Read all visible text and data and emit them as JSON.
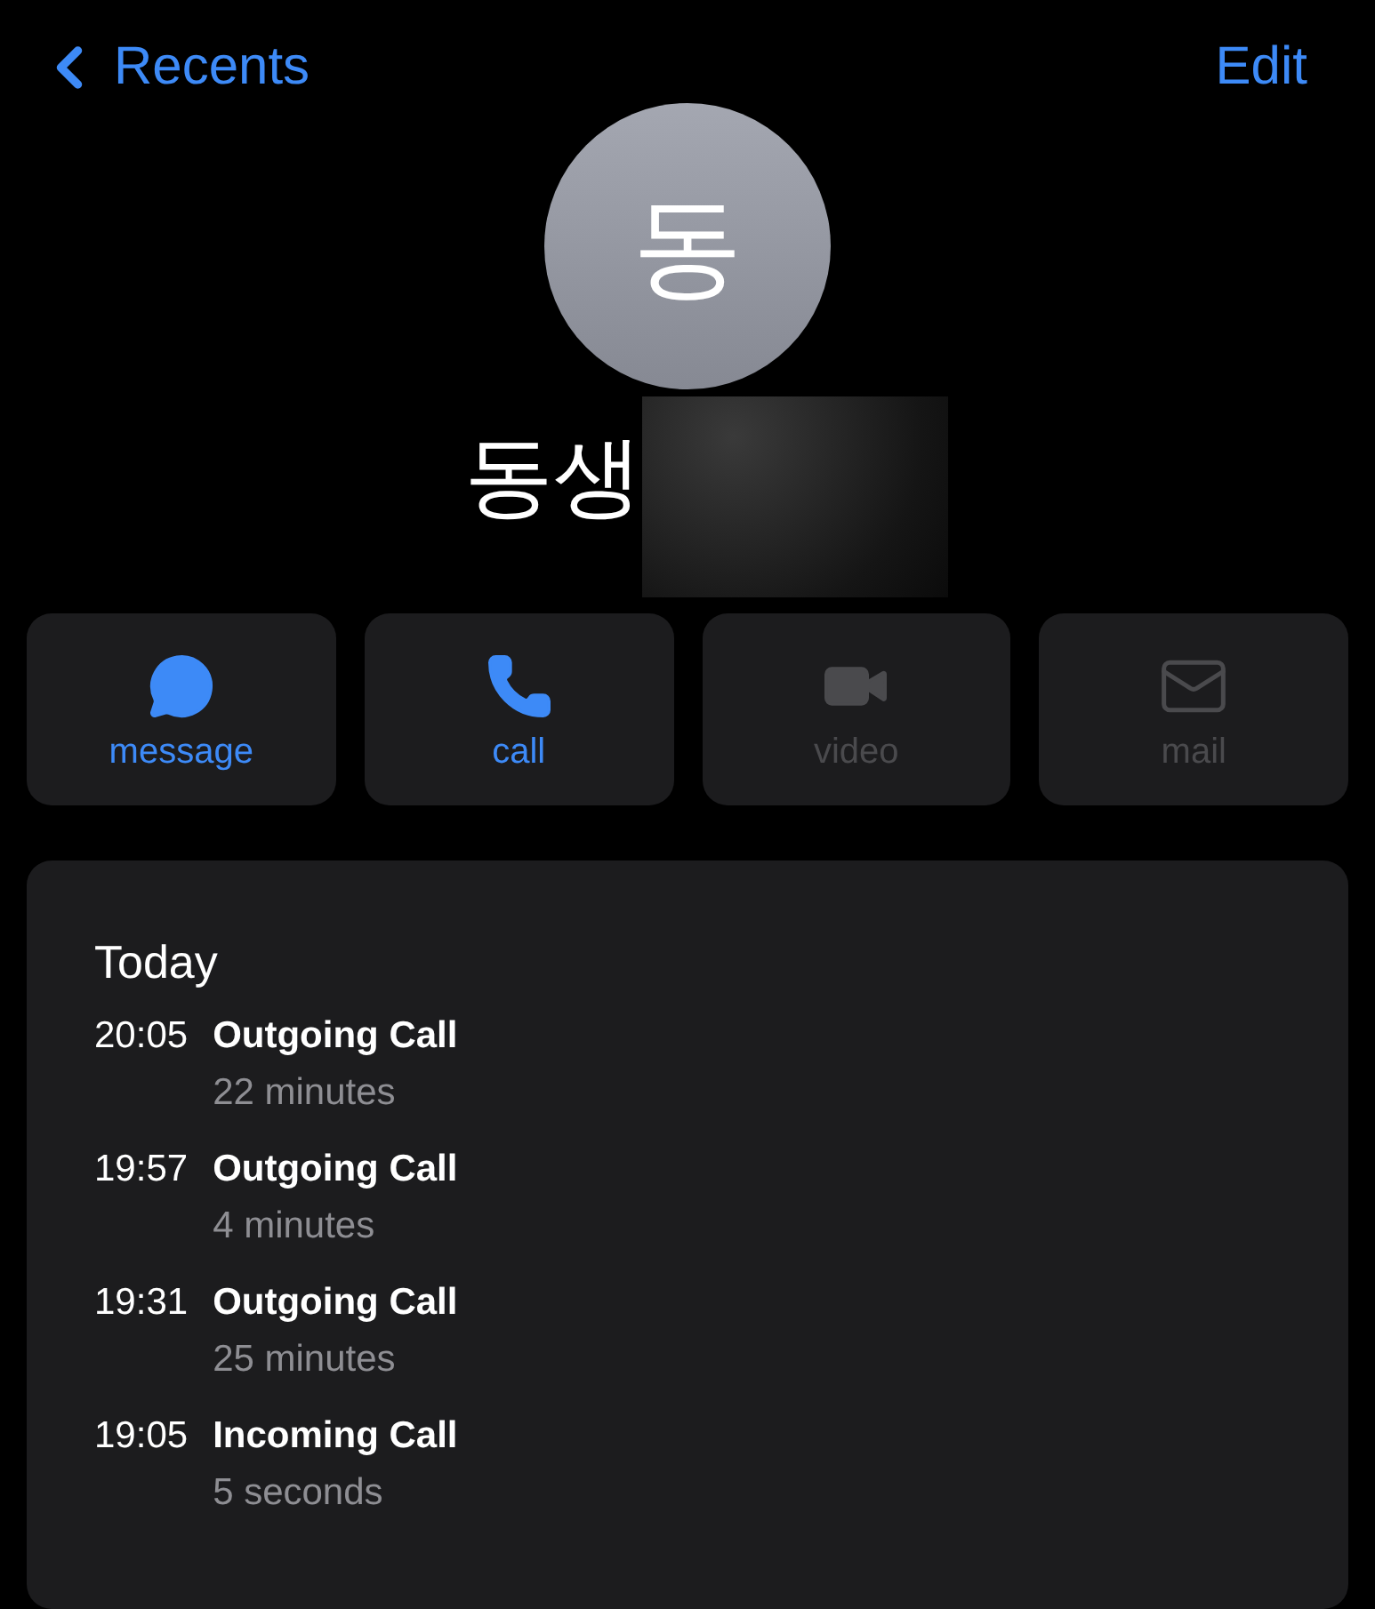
{
  "nav": {
    "back_label": "Recents",
    "edit_label": "Edit"
  },
  "contact": {
    "initial": "동",
    "name": "동생",
    "name_redacted": true
  },
  "actions": [
    {
      "kind": "message",
      "label": "message",
      "disabled": false
    },
    {
      "kind": "call",
      "label": "call",
      "disabled": false
    },
    {
      "kind": "video",
      "label": "video",
      "disabled": true
    },
    {
      "kind": "mail",
      "label": "mail",
      "disabled": true
    }
  ],
  "history": {
    "heading": "Today",
    "calls": [
      {
        "time": "20:05",
        "type": "Outgoing Call",
        "duration": "22 minutes"
      },
      {
        "time": "19:57",
        "type": "Outgoing Call",
        "duration": "4 minutes"
      },
      {
        "time": "19:31",
        "type": "Outgoing Call",
        "duration": "25 minutes"
      },
      {
        "time": "19:05",
        "type": "Incoming Call",
        "duration": "5 seconds"
      }
    ]
  }
}
